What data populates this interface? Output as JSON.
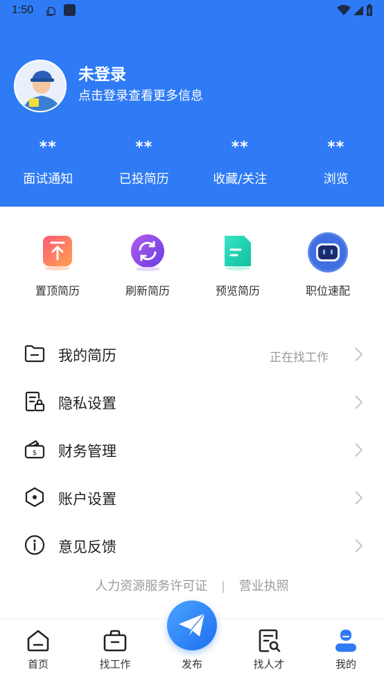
{
  "status_bar": {
    "time": "1:50"
  },
  "profile": {
    "name": "未登录",
    "subtitle": "点击登录查看更多信息"
  },
  "stats": [
    {
      "value": "**",
      "label": "面试通知"
    },
    {
      "value": "**",
      "label": "已投简历"
    },
    {
      "value": "**",
      "label": "收藏/关注"
    },
    {
      "value": "**",
      "label": "浏览"
    }
  ],
  "quick_actions": [
    {
      "label": "置顶简历",
      "icon": "pin-top-icon",
      "color": "#ff6b6b"
    },
    {
      "label": "刷新简历",
      "icon": "refresh-icon",
      "color": "#8a4be8"
    },
    {
      "label": "预览简历",
      "icon": "document-icon",
      "color": "#1fd1b0"
    },
    {
      "label": "职位速配",
      "icon": "robot-match-icon",
      "color": "#3f6fe0"
    }
  ],
  "menu": [
    {
      "label": "我的简历",
      "value": "正在找工作",
      "icon": "folder-icon"
    },
    {
      "label": "隐私设置",
      "value": "",
      "icon": "privacy-lock-icon"
    },
    {
      "label": "财务管理",
      "value": "",
      "icon": "wallet-icon"
    },
    {
      "label": "账户设置",
      "value": "",
      "icon": "hexagon-settings-icon"
    },
    {
      "label": "意见反馈",
      "value": "",
      "icon": "info-icon"
    }
  ],
  "footer_links": {
    "license": "人力资源服务许可证",
    "separator": "|",
    "business": "营业执照"
  },
  "tabbar": [
    {
      "label": "首页",
      "icon": "home-icon"
    },
    {
      "label": "找工作",
      "icon": "briefcase-icon"
    },
    {
      "label": "发布",
      "icon": "paper-plane-icon"
    },
    {
      "label": "找人才",
      "icon": "search-document-icon"
    },
    {
      "label": "我的",
      "icon": "user-icon",
      "active": true
    }
  ],
  "colors": {
    "primary": "#2f7bf5",
    "active_tab": "#2f7bf5"
  }
}
